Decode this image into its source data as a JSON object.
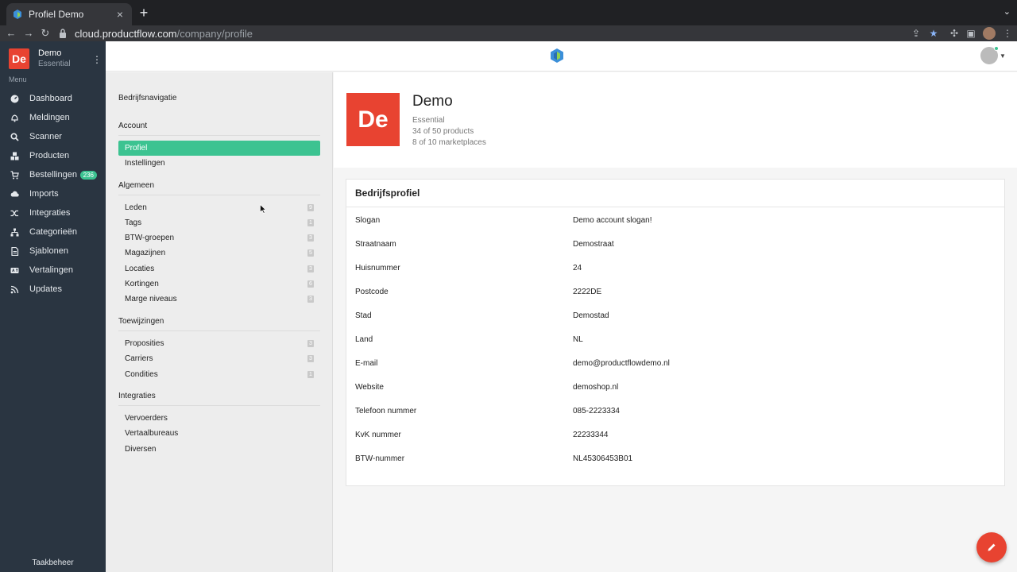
{
  "browser": {
    "tab_title": "Profiel Demo",
    "tab_close": "×",
    "new_tab": "+",
    "url_host": "cloud.productflow.com",
    "url_path": "/company/profile"
  },
  "sidebar": {
    "company_initials": "De",
    "company_name": "Demo",
    "company_plan": "Essential",
    "menu_label": "Menu",
    "items": [
      {
        "label": "Dashboard",
        "icon": "dashboard-icon"
      },
      {
        "label": "Meldingen",
        "icon": "bell-icon"
      },
      {
        "label": "Scanner",
        "icon": "search-icon"
      },
      {
        "label": "Producten",
        "icon": "cubes-icon"
      },
      {
        "label": "Bestellingen",
        "icon": "cart-icon",
        "badge": "236"
      },
      {
        "label": "Imports",
        "icon": "cloud-upload-icon"
      },
      {
        "label": "Integraties",
        "icon": "shuffle-icon"
      },
      {
        "label": "Categorieën",
        "icon": "sitemap-icon"
      },
      {
        "label": "Sjablonen",
        "icon": "file-icon"
      },
      {
        "label": "Vertalingen",
        "icon": "language-icon"
      },
      {
        "label": "Updates",
        "icon": "rss-icon"
      }
    ],
    "footer": "Taakbeheer"
  },
  "company_nav": {
    "title": "Bedrijfsnavigatie",
    "sections": [
      {
        "title": "Account",
        "items": [
          {
            "label": "Profiel",
            "active": true
          },
          {
            "label": "Instellingen"
          }
        ]
      },
      {
        "title": "Algemeen",
        "items": [
          {
            "label": "Leden",
            "count": "9"
          },
          {
            "label": "Tags",
            "count": "1"
          },
          {
            "label": "BTW-groepen",
            "count": "3"
          },
          {
            "label": "Magazijnen",
            "count": "5"
          },
          {
            "label": "Locaties",
            "count": "3"
          },
          {
            "label": "Kortingen",
            "count": "6"
          },
          {
            "label": "Marge niveaus",
            "count": "3"
          }
        ]
      },
      {
        "title": "Toewijzingen",
        "items": [
          {
            "label": "Proposities",
            "count": "3"
          },
          {
            "label": "Carriers",
            "count": "3"
          },
          {
            "label": "Condities",
            "count": "1"
          }
        ]
      },
      {
        "title": "Integraties",
        "items": [
          {
            "label": "Vervoerders"
          },
          {
            "label": "Vertaalbureaus"
          },
          {
            "label": "Diversen"
          }
        ]
      }
    ]
  },
  "header": {
    "initials": "De",
    "name": "Demo",
    "plan": "Essential",
    "products": "34 of 50 products",
    "marketplaces": "8 of 10 marketplaces"
  },
  "profile": {
    "title": "Bedrijfsprofiel",
    "rows": [
      {
        "key": "Slogan",
        "value": "Demo account slogan!"
      },
      {
        "key": "Straatnaam",
        "value": "Demostraat"
      },
      {
        "key": "Huisnummer",
        "value": "24"
      },
      {
        "key": "Postcode",
        "value": "2222DE"
      },
      {
        "key": "Stad",
        "value": "Demostad"
      },
      {
        "key": "Land",
        "value": "NL"
      },
      {
        "key": "E-mail",
        "value": "demo@productflowdemo.nl"
      },
      {
        "key": "Website",
        "value": "demoshop.nl"
      },
      {
        "key": "Telefoon nummer",
        "value": "085-2223334"
      },
      {
        "key": "KvK nummer",
        "value": "22233344"
      },
      {
        "key": "BTW-nummer",
        "value": "NL45306453B01"
      }
    ]
  },
  "colors": {
    "accent": "#3cc391",
    "brand_red": "#e84331",
    "sidebar_bg": "#2a3541"
  }
}
